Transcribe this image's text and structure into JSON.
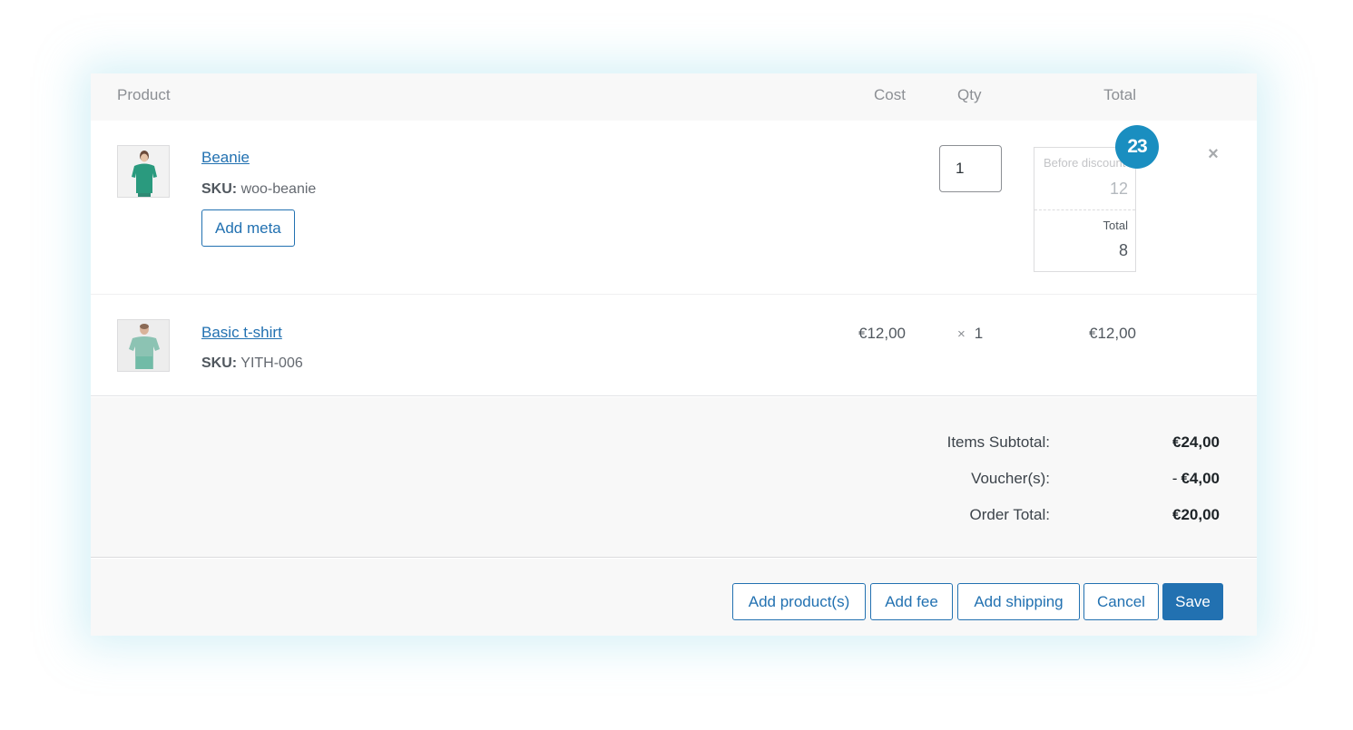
{
  "table_header": {
    "product": "Product",
    "cost": "Cost",
    "qty": "Qty",
    "total": "Total"
  },
  "items": [
    {
      "name": "Beanie",
      "sku_label": "SKU:",
      "sku": "woo-beanie",
      "add_meta_label": "Add meta",
      "qty_value": "1",
      "before_discount_label": "Before discount",
      "before_discount_value": "12",
      "total_label": "Total",
      "total_value": "8",
      "badge": "23",
      "remove_icon": "close-icon"
    },
    {
      "name": "Basic t-shirt",
      "sku_label": "SKU:",
      "sku": "YITH-006",
      "cost": "€12,00",
      "qty_prefix": "×",
      "qty": "1",
      "total": "€12,00"
    }
  ],
  "totals": {
    "subtotal_label": "Items Subtotal:",
    "subtotal_value": "€24,00",
    "voucher_label": "Voucher(s):",
    "voucher_minus": "-",
    "voucher_value": "€4,00",
    "order_total_label": "Order Total:",
    "order_total_value": "€20,00"
  },
  "actions": {
    "add_products": "Add product(s)",
    "add_fee": "Add fee",
    "add_shipping": "Add shipping",
    "cancel": "Cancel",
    "save": "Save"
  },
  "colors": {
    "accent": "#2271b1",
    "badge": "#1a8ec0",
    "panel_bg": "#f8f8f8"
  }
}
